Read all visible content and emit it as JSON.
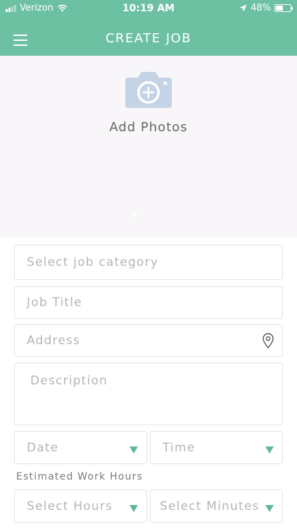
{
  "colors": {
    "brand": "#6cc1a3",
    "accent_triangle": "#5fb898",
    "icon_blue": "#c5d3e6"
  },
  "status_bar": {
    "carrier": "Verizon",
    "time": "10:19 AM",
    "battery": "48%",
    "battery_level": 0.48
  },
  "header": {
    "title": "CREATE JOB",
    "menu_icon": "hamburger-menu-icon"
  },
  "photos": {
    "label": "Add Photos",
    "icon": "camera-add-icon"
  },
  "form": {
    "category_placeholder": "Select job category",
    "title_placeholder": "Job Title",
    "address_placeholder": "Address",
    "description_placeholder": "Description",
    "date_placeholder": "Date",
    "time_placeholder": "Time",
    "estimated_hours_label": "Estimated Work Hours",
    "hours_placeholder": "Select Hours",
    "minutes_placeholder": "Select Minutes"
  }
}
